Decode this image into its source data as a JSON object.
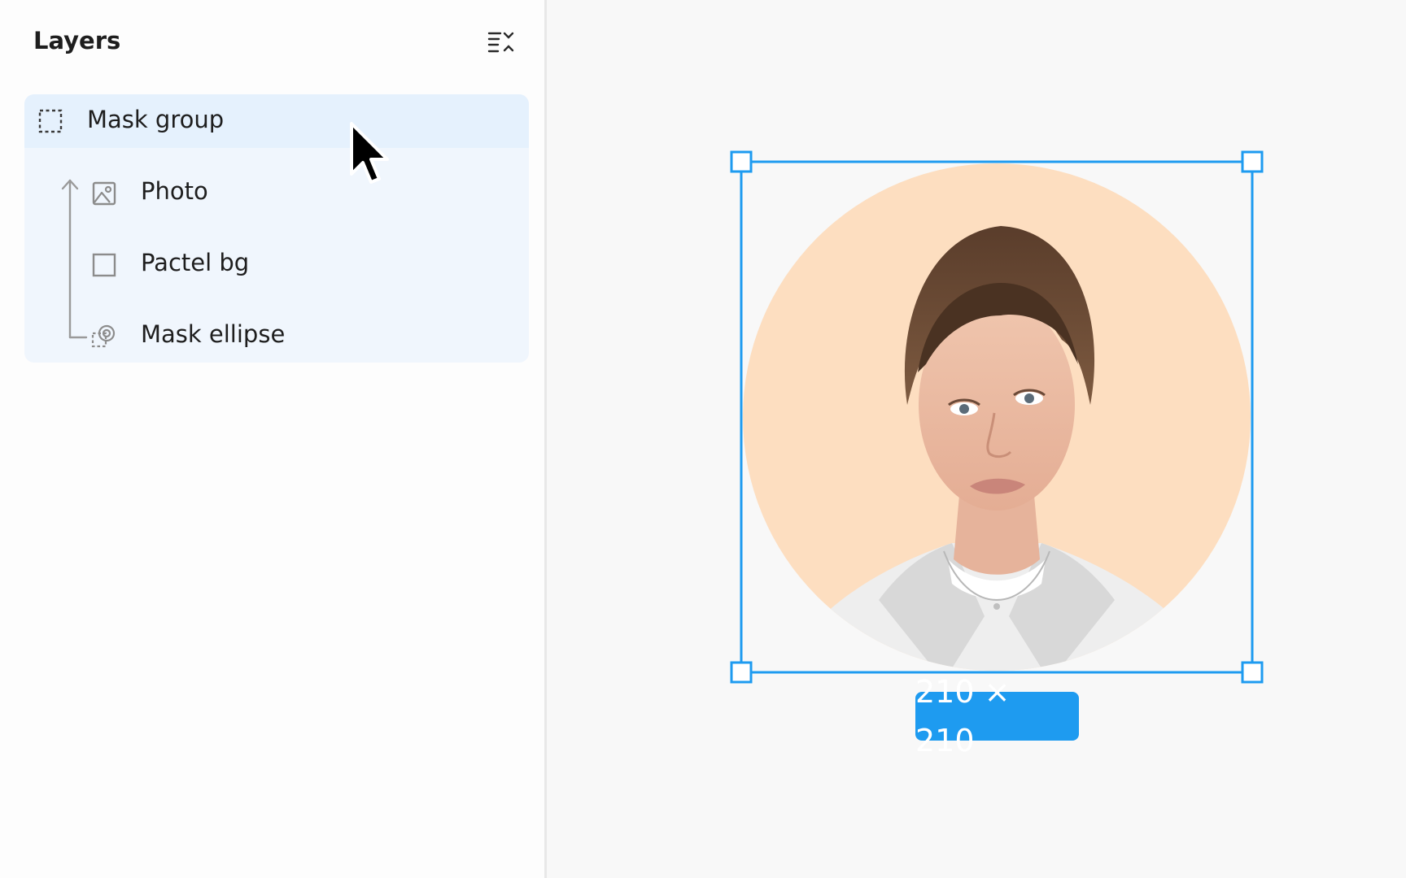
{
  "panel": {
    "title": "Layers"
  },
  "layers": [
    {
      "label": "Mask group",
      "icon": "mask-group-icon",
      "selected": true
    },
    {
      "label": "Photo",
      "icon": "image-icon"
    },
    {
      "label": "Pactel bg",
      "icon": "rectangle-icon"
    },
    {
      "label": "Mask ellipse",
      "icon": "mask-ellipse-icon"
    }
  ],
  "canvas": {
    "selection_size": "210 × 210",
    "selection_color": "#1e9bf0",
    "background_circle_color": "#fddec0"
  },
  "colors": {
    "hover_row": "#e5f1fd",
    "group_bg": "#f0f6fd",
    "accent": "#1e9bf0"
  }
}
